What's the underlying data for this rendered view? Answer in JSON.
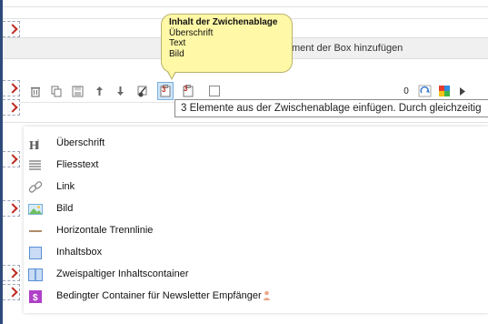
{
  "clipboard_bubble": {
    "title": "Inhalt der Zwichenablage",
    "items": [
      "Überschrift",
      "Text",
      "Bild"
    ]
  },
  "add_element_hint": "ment der Box hinzufügen",
  "tooltip": "3 Elemente aus der Zwischenablage einfügen. Durch gleichzeitig",
  "toolbar": {
    "paste_count": "3",
    "paste_alt_count": "3",
    "counter": "0",
    "icons": [
      "trash-icon",
      "copy-icon",
      "save-icon",
      "arrow-up-icon",
      "arrow-down-icon",
      "cut-icon",
      "paste-icon",
      "paste-alt-icon",
      "checkbox-icon",
      "counter-badge",
      "refresh-icon",
      "color-grid-icon",
      "triangle-right-icon"
    ]
  },
  "menu": {
    "items": [
      {
        "label": "Überschrift",
        "icon": "heading-icon"
      },
      {
        "label": "Fliesstext",
        "icon": "text-lines-icon"
      },
      {
        "label": "Link",
        "icon": "link-icon"
      },
      {
        "label": "Bild",
        "icon": "image-icon"
      },
      {
        "label": "Horizontale Trennlinie",
        "icon": "horizontal-line-icon"
      },
      {
        "label": "Inhaltsbox",
        "icon": "box-icon"
      },
      {
        "label": "Zweispaltiger Inhaltscontainer",
        "icon": "two-column-icon"
      },
      {
        "label": "Bedingter Container für Newsletter Empfänger",
        "icon": "conditional-dollar-icon"
      }
    ]
  },
  "colors": {
    "accent_red": "#c0281f",
    "bubble_bg": "#fff8a6",
    "menu_icon_blue": "#5b8fd6",
    "conditional_purple": "#b040c8"
  }
}
